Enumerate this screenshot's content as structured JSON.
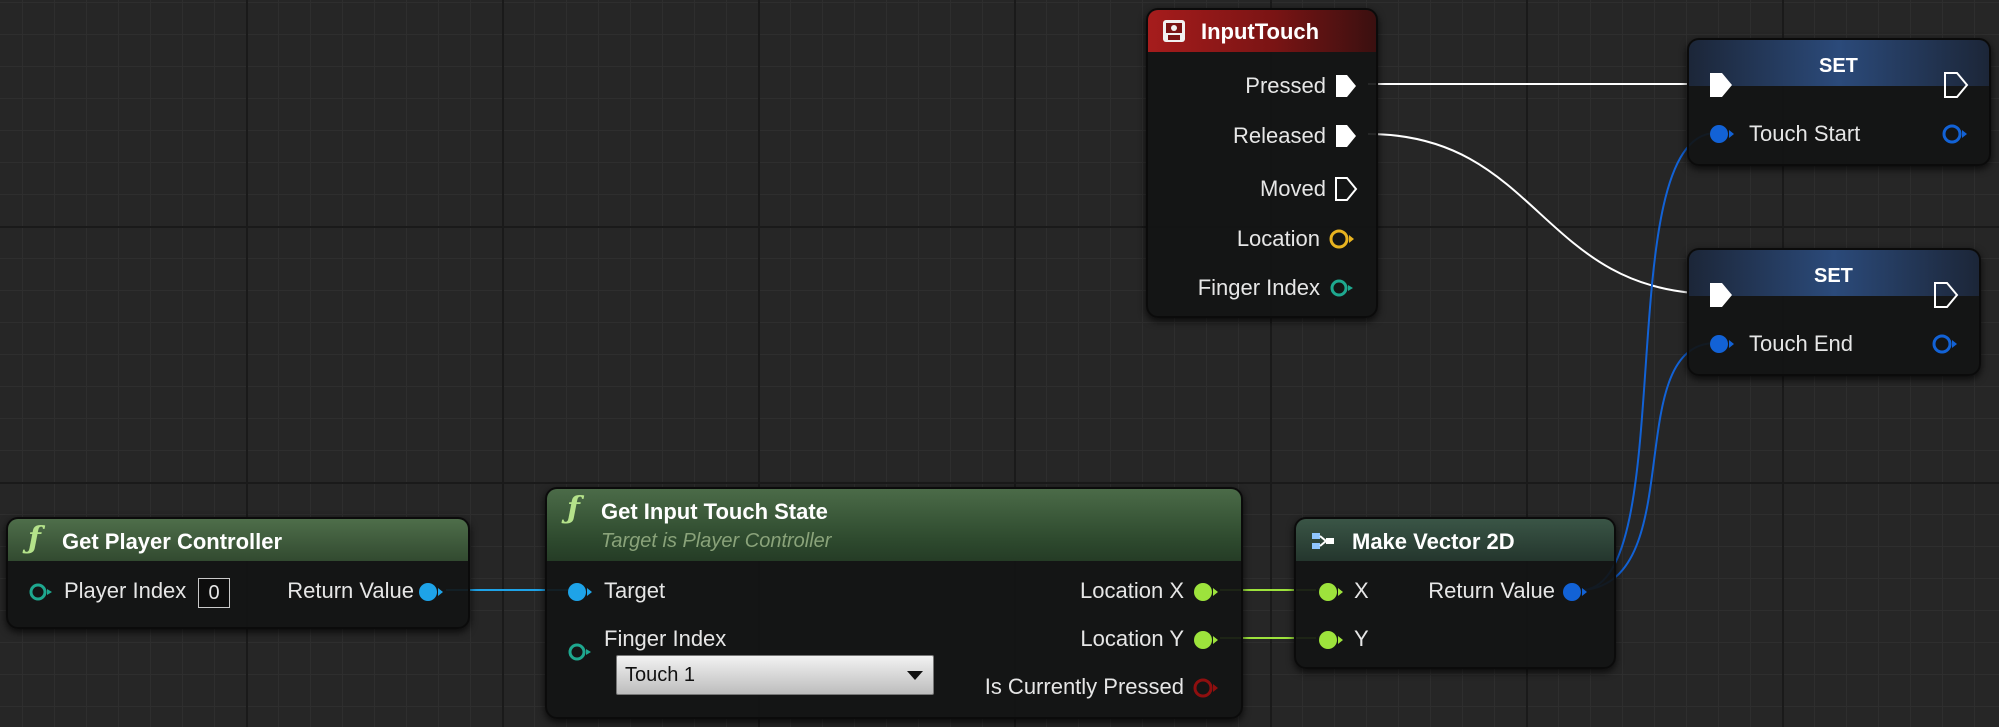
{
  "nodes": {
    "input_touch": {
      "title": "InputTouch",
      "pins": {
        "pressed": "Pressed",
        "released": "Released",
        "moved": "Moved",
        "location": "Location",
        "finger_index": "Finger Index"
      }
    },
    "set_touch_start": {
      "title": "SET",
      "variable": "Touch Start"
    },
    "set_touch_end": {
      "title": "SET",
      "variable": "Touch End"
    },
    "get_player_controller": {
      "title": "Get Player Controller",
      "pins": {
        "player_index": "Player Index",
        "player_index_value": "0",
        "return_value": "Return Value"
      }
    },
    "get_input_touch_state": {
      "title": "Get Input Touch State",
      "subtitle": "Target is Player Controller",
      "pins": {
        "target": "Target",
        "finger_index": "Finger Index",
        "finger_index_selected": "Touch 1",
        "location_x": "Location X",
        "location_y": "Location Y",
        "is_currently_pressed": "Is Currently Pressed"
      }
    },
    "make_vector_2d": {
      "title": "Make Vector 2D",
      "pins": {
        "x": "X",
        "y": "Y",
        "return_value": "Return Value"
      }
    }
  },
  "colors": {
    "exec": "#ffffff",
    "object": "#1ea3e8",
    "float": "#9de33c",
    "vector2d": "#1262d6",
    "struct_location": "#e8b320",
    "int": "#1ea88f",
    "bool": "#8f0f0f",
    "event_header": "#7a1414",
    "function_header": "#3f5e3c",
    "pure_header": "#2d4a3a",
    "set_header": "#2b4a7a"
  },
  "icons": {
    "function": "function-icon",
    "event": "event-icon",
    "make_struct": "make-struct-icon"
  }
}
